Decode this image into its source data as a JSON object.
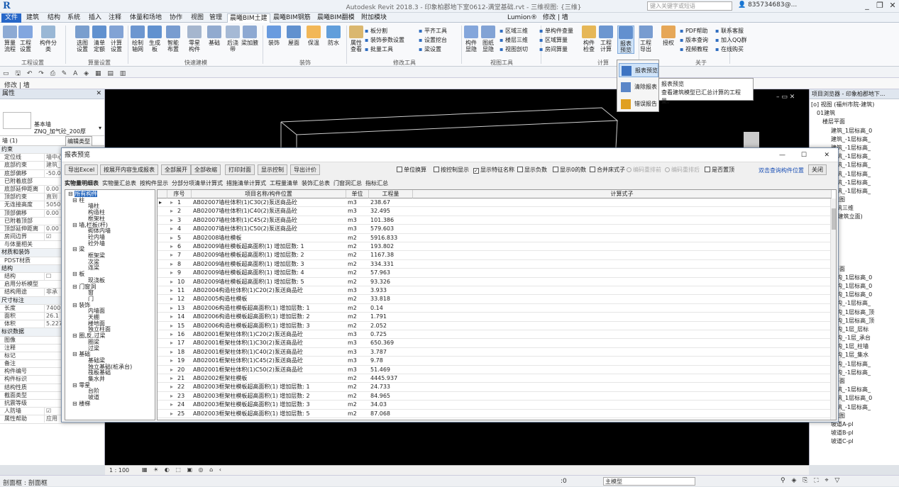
{
  "window": {
    "title": "Autodesk Revit 2018.3 -   印象柏郡地下室0612-满堂基础.rvt - 三维视图: {三维}",
    "search_placeholder": "键入关键字或短语",
    "user": "835734683@..."
  },
  "tabs": [
    "文件",
    "建筑",
    "结构",
    "系统",
    "插入",
    "注释",
    "体量和场地",
    "协作",
    "视图",
    "管理",
    "晨曦BIM土建",
    "晨曦BIM钢筋",
    "晨曦BIM翻模",
    "附加模块",
    "Lumion®",
    "修改 | 墙"
  ],
  "ribbon": {
    "groups": [
      "工程设置",
      "算量设置",
      "快速建模",
      "装饰",
      "修改工具",
      "视图工具",
      "计算",
      "关于"
    ],
    "buttons": [
      [
        "算量",
        "流程"
      ],
      [
        "工程",
        "设置"
      ],
      [
        "构件分类",
        ""
      ],
      [
        "选图",
        "设置"
      ],
      [
        "清单",
        "定额"
      ],
      [
        "计算",
        "设置"
      ],
      [
        "绘制",
        "轴网"
      ],
      [
        "生成",
        "板"
      ],
      [
        "智能",
        "布置"
      ],
      [
        "零星",
        "构件"
      ],
      [
        "基础",
        ""
      ],
      [
        "后浇",
        "带"
      ],
      [
        "梁加腋",
        ""
      ],
      [
        "装饰",
        ""
      ],
      [
        "屋面",
        ""
      ],
      [
        "保温",
        ""
      ],
      [
        "防水",
        ""
      ],
      [
        "属性",
        "查看"
      ],
      [
        "构件",
        "显隐"
      ],
      [
        "图纸",
        "显隐"
      ],
      [
        "构件",
        "检查"
      ],
      [
        "工程",
        "计算"
      ],
      [
        "报表",
        "预览"
      ],
      [
        "工程",
        "导出"
      ],
      [
        "授权",
        ""
      ]
    ],
    "small": [
      "板分割",
      "装饰参数设置",
      "批量工具",
      "平齐工具",
      "设置挖台",
      "梁设置",
      "区域三维",
      "楼层三维",
      "视图剖切",
      "单构件查量",
      "区域算量",
      "房间算量",
      "PDF帮助",
      "版本查询",
      "视频教程",
      "联系客服",
      "加入QQ群",
      "在线购买"
    ]
  },
  "qat": "",
  "context": "修改 | 墙",
  "properties": {
    "title": "属性",
    "type_name": "基本墙",
    "type_sub": "ZNQ_加气砼_200厚",
    "instance": "墙 (1)",
    "edit_type": "编辑类型",
    "rows": [
      [
        "约束",
        "",
        true
      ],
      [
        "定位线",
        "墙中心",
        false
      ],
      [
        "底部约束",
        "建筑_",
        false
      ],
      [
        "底部偏移",
        "-50.0",
        false
      ],
      [
        "已附着底部",
        "",
        false
      ],
      [
        "底部延伸距离",
        "0.00",
        false
      ],
      [
        "顶部约束",
        "直到",
        false
      ],
      [
        "无连接高度",
        "5050",
        false
      ],
      [
        "顶部偏移",
        "0.00",
        false
      ],
      [
        "已附着顶部",
        "",
        false
      ],
      [
        "顶部延伸距离",
        "0.00",
        false
      ],
      [
        "房间边界",
        "☑",
        false
      ],
      [
        "与体量相关",
        "",
        false
      ],
      [
        "材质和装饰",
        "",
        true
      ],
      [
        "PDST材质",
        "",
        false
      ],
      [
        "结构",
        "",
        true
      ],
      [
        "结构",
        "☐",
        false
      ],
      [
        "启用分析模型",
        "",
        false
      ],
      [
        "结构用途",
        "非承",
        false
      ],
      [
        "尺寸标注",
        "",
        true
      ],
      [
        "长度",
        "7400",
        false
      ],
      [
        "面积",
        "26.1",
        false
      ],
      [
        "体积",
        "5.227",
        false
      ],
      [
        "标识数据",
        "",
        true
      ],
      [
        "图像",
        "",
        false
      ],
      [
        "注释",
        "",
        false
      ],
      [
        "标记",
        "",
        false
      ],
      [
        "备注",
        "",
        false
      ],
      [
        "构件编号",
        "",
        false
      ],
      [
        "构件标识",
        "",
        false
      ],
      [
        "结构性质",
        "",
        false
      ],
      [
        "截面类型",
        "",
        false
      ],
      [
        "抗震等级",
        "",
        false
      ],
      [
        "人防墙",
        "☑",
        false
      ],
      [
        "属性帮助",
        "应用",
        false
      ]
    ]
  },
  "browser": {
    "title": "项目浏览器 - 印象柏郡地下...",
    "items": [
      "[o] 视图 (福州市院-建筑)",
      "01建筑",
      "楼层平面",
      "建筑_1层标高_0",
      "建筑_-1层标高_",
      "建筑_-1层标高_",
      "建筑_-1层标高_",
      "建筑_-1层标高_",
      "建筑_-1层标高_",
      "建筑_-1层标高_",
      "建筑_-1层标高_",
      "三维视图",
      "建筑三维",
      "立面 (建筑立面)",
      "东",
      "北",
      "南",
      "西",
      "结构",
      "结构平面",
      "结构_1层标高_0",
      "结构_1层标高_0",
      "结构_1层标高_0",
      "结构_-1层标高_",
      "结构_1层标高_顶",
      "结构_1层标高_顶",
      "结构_1层_层标",
      "结构_-1层_承台",
      "结构_1层_柱墙",
      "结构_1层_集水",
      "结构_-1层标高_",
      "结构_-1层标高_",
      "楼层平面",
      "建筑_-1层标高_",
      "建筑_1层标高_0",
      "建筑_-1层标高_",
      "三维视图",
      "坡道A-pl",
      "坡道B-pl",
      "坡道C-pl"
    ]
  },
  "dialog": {
    "title": "报表预览",
    "buttons": [
      "导出Excel",
      "按展开内容生成报表",
      "全部展开",
      "全部收缩",
      "打印封面",
      "显示控制",
      "导出计价"
    ],
    "close": "关闭",
    "locate": "双击查询构件位置",
    "checks": [
      [
        "单位换算",
        false
      ],
      [
        "按控制显示",
        false
      ],
      [
        "显示特征名称",
        true
      ],
      [
        "显示负数",
        false
      ],
      [
        "显示0的数",
        false
      ],
      [
        "合并床式子",
        false
      ],
      [
        "编码重排前",
        false
      ],
      [
        "编码重排后",
        false
      ],
      [
        "是否置顶",
        false
      ]
    ],
    "sheets": [
      "实物量明细表",
      "实物量汇总表",
      "按构件显示",
      "分部分项清单计算式",
      "措施清单计算式",
      "工程量清单",
      "装饰汇总表",
      "门窗洞汇总",
      "指标汇总"
    ],
    "columns": [
      "序号",
      "项目名称/构件位置",
      "单位",
      "工程量",
      "计算式子"
    ],
    "tree": [
      "所有构件",
      "柱",
      "墙柱",
      "构造柱",
      "框架柱",
      "墙,栏板(杆)",
      "砌体内墙",
      "砼内墙",
      "砼外墙",
      "梁",
      "框架梁",
      "次梁",
      "连梁",
      "板",
      "现浇板",
      "门窗洞",
      "窗",
      "门",
      "装饰",
      "内墙面",
      "天棚",
      "楼地面",
      "独立柱面",
      "圈,反,过梁",
      "圈梁",
      "过梁",
      "基础",
      "基础梁",
      "独立基础(桩承台)",
      "筏板基础",
      "集水井",
      "零星",
      "台阶",
      "坡道",
      "楼梯"
    ],
    "rows": [
      [
        "1",
        "AB02007墙柱体积(1)C30(2)泵送商品砼",
        "m3",
        "238.67"
      ],
      [
        "2",
        "AB02007墙柱体积(1)C40(2)泵送商品砼",
        "m3",
        "32.495"
      ],
      [
        "3",
        "AB02007墙柱体积(1)C45(2)泵送商品砼",
        "m3",
        "101.386"
      ],
      [
        "4",
        "AB02007墙柱体积(1)C50(2)泵送商品砼",
        "m3",
        "579.603"
      ],
      [
        "5",
        "AB02008墙柱模板",
        "m2",
        "5916.833"
      ],
      [
        "6",
        "AB02009墙柱模板超高面积(1) 增加层数: 1",
        "m2",
        "193.802"
      ],
      [
        "7",
        "AB02009墙柱模板超高面积(1) 增加层数: 2",
        "m2",
        "1167.38"
      ],
      [
        "8",
        "AB02009墙柱模板超高面积(1) 增加层数: 3",
        "m2",
        "334.331"
      ],
      [
        "9",
        "AB02009墙柱模板超高面积(1) 增加层数: 4",
        "m2",
        "57.963"
      ],
      [
        "10",
        "AB02009墙柱模板超高面积(1) 增加层数: 5",
        "m2",
        "93.326"
      ],
      [
        "11",
        "AB02004构造柱体积(1)C20(2)泵送商品砼",
        "m3",
        "3.933"
      ],
      [
        "12",
        "AB02005构造柱模板",
        "m2",
        "33.818"
      ],
      [
        "13",
        "AB02006构造柱模板超高面积(1) 增加层数: 1",
        "m2",
        "0.14"
      ],
      [
        "14",
        "AB02006构造柱模板超高面积(1) 增加层数: 2",
        "m2",
        "1.791"
      ],
      [
        "15",
        "AB02006构造柱模板超高面积(1) 增加层数: 3",
        "m2",
        "2.052"
      ],
      [
        "16",
        "AB02001框架柱体积(1)C20(2)泵送商品砼",
        "m3",
        "0.725"
      ],
      [
        "17",
        "AB02001框架柱体积(1)C30(2)泵送商品砼",
        "m3",
        "650.369"
      ],
      [
        "18",
        "AB02001框架柱体积(1)C40(2)泵送商品砼",
        "m3",
        "3.787"
      ],
      [
        "19",
        "AB02001框架柱体积(1)C45(2)泵送商品砼",
        "m3",
        "9.78"
      ],
      [
        "20",
        "AB02001框架柱体积(1)C50(2)泵送商品砼",
        "m3",
        "51.469"
      ],
      [
        "21",
        "AB02002框架柱模板",
        "m2",
        "4445.937"
      ],
      [
        "22",
        "AB02003框架柱模板超高面积(1) 增加层数: 1",
        "m2",
        "24.733"
      ],
      [
        "23",
        "AB02003框架柱模板超高面积(1) 增加层数: 2",
        "m2",
        "84.965"
      ],
      [
        "24",
        "AB02003框架柱模板超高面积(1) 增加层数: 3",
        "m2",
        "34.03"
      ],
      [
        "25",
        "AB02003框架柱模板超高面积(1) 增加层数: 5",
        "m2",
        "87.068"
      ]
    ]
  },
  "menu": [
    "报表预览",
    "清除报表",
    "错误报告"
  ],
  "tooltip": {
    "title": "报表预览",
    "text": "查看建筑模型已汇总计算的工程量。"
  },
  "viewctl": {
    "scale": "1 : 100"
  },
  "status": {
    "left": "剖面框 : 剖面框",
    "model": "主模型",
    "zero": ":0"
  }
}
